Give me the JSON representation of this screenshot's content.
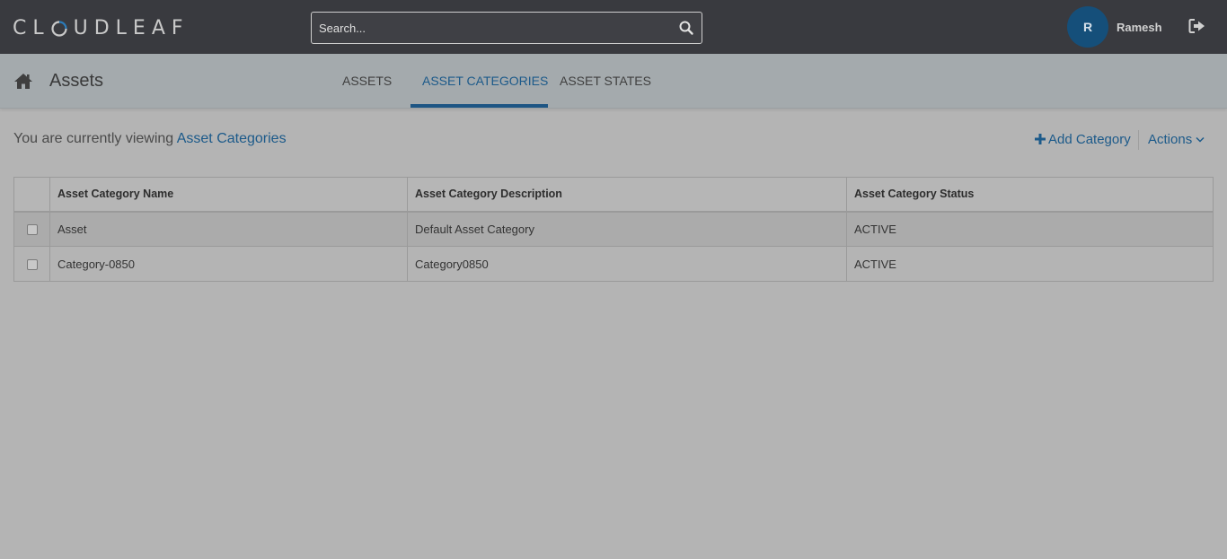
{
  "brand": {
    "logo_text": "CLOUDLEAF"
  },
  "search": {
    "placeholder": "Search..."
  },
  "user": {
    "initial": "R",
    "name": "Ramesh"
  },
  "header": {
    "title": "Assets",
    "tabs": [
      {
        "label": "ASSETS",
        "active": false
      },
      {
        "label": "ASSET CATEGORIES",
        "active": true
      },
      {
        "label": "ASSET STATES",
        "active": false
      }
    ]
  },
  "content": {
    "viewing_prefix": "You are currently viewing",
    "viewing_target": "Asset Categories",
    "add_category_label": "Add Category",
    "actions_label": "Actions"
  },
  "table": {
    "columns": [
      "Asset Category Name",
      "Asset Category Description",
      "Asset Category Status"
    ],
    "rows": [
      {
        "name": "Asset",
        "description": "Default Asset Category",
        "status": "ACTIVE"
      },
      {
        "name": "Category-0850",
        "description": "Category0850",
        "status": "ACTIVE"
      }
    ]
  },
  "colors": {
    "topbar": "#393a3f",
    "accent": "#1c5a8a",
    "avatar": "#154f7a",
    "background": "#b4b4b4"
  },
  "icons": [
    "search-icon",
    "logout-icon",
    "home-icon",
    "plus-icon",
    "chevron-down-icon"
  ]
}
